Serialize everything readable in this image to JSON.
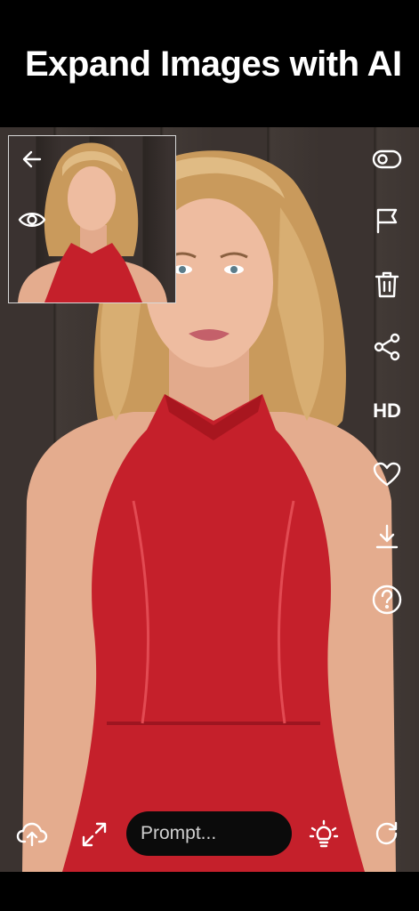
{
  "header": {
    "title": "Expand Images with AI"
  },
  "preview": {
    "back_icon": "arrow-left-icon",
    "compare_icon": "eye-icon"
  },
  "side_actions": [
    {
      "name": "toggle-icon"
    },
    {
      "name": "flag-icon"
    },
    {
      "name": "trash-icon"
    },
    {
      "name": "share-icon"
    },
    {
      "name": "hd-badge",
      "label": "HD"
    },
    {
      "name": "heart-icon"
    },
    {
      "name": "download-icon"
    },
    {
      "name": "help-icon"
    }
  ],
  "bottom": {
    "upload_icon": "cloud-upload-icon",
    "expand_icon": "expand-icon",
    "prompt_placeholder": "Prompt...",
    "idea_icon": "lightbulb-icon",
    "redo_icon": "refresh-icon"
  },
  "colors": {
    "dress": "#c5202b",
    "hair": "#d9b27a",
    "skin": "#e9b79b",
    "wall": "#3b3330"
  }
}
